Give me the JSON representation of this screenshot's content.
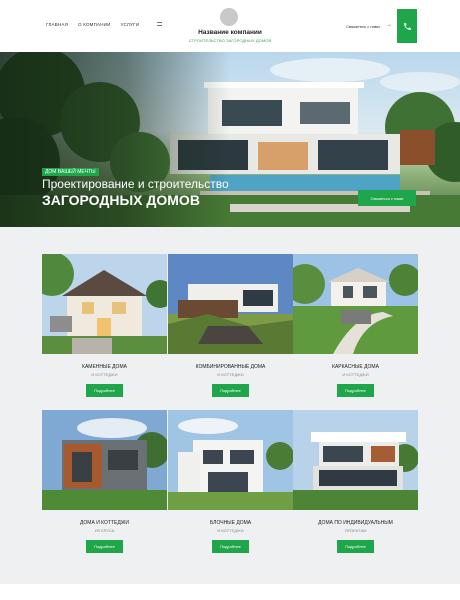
{
  "header": {
    "nav": [
      "ГЛАВНАЯ",
      "О КОМПАНИИ",
      "УСЛУГИ"
    ],
    "company_name": "Название компании",
    "tagline": "СТРОИТЕЛЬСТВО ЗАГОРОДНЫХ ДОМОВ",
    "contact_link": "Свяжитесь с нами",
    "menu_icon": "hamburger-icon",
    "phone_icon": "phone-icon",
    "accent": "#1fa54a"
  },
  "hero": {
    "badge": "ДОМ ВАШЕЙ МЕЧТЫ",
    "line1": "Проектирование и строительство",
    "line2": "ЗАГОРОДНЫХ ДОМОВ",
    "cta": "Связаться с нами"
  },
  "services": {
    "items": [
      {
        "title": "КАМЕННЫЕ ДОМА",
        "subtitle": "И КОТТЕДЖИ",
        "button": "Подробнее"
      },
      {
        "title": "КОМБИНИРОВАННЫЕ ДОМА",
        "subtitle": "И КОТТЕДЖИ",
        "button": "Подробнее"
      },
      {
        "title": "КАРКАСНЫЕ ДОМА",
        "subtitle": "И КОТТЕДЖИ",
        "button": "Подробнее"
      },
      {
        "title": "ДОМА И КОТТЕДЖИ",
        "subtitle": "ИЗ БРУСА",
        "button": "Подробнее"
      },
      {
        "title": "БЛОЧНЫЕ ДОМА",
        "subtitle": "И КОТТЕДЖИ",
        "button": "Подробнее"
      },
      {
        "title": "ДОМА ПО ИНДИВИДУАЛЬНЫМ",
        "subtitle": "ПРОЕКТАМ",
        "button": "Подробнее"
      }
    ]
  }
}
